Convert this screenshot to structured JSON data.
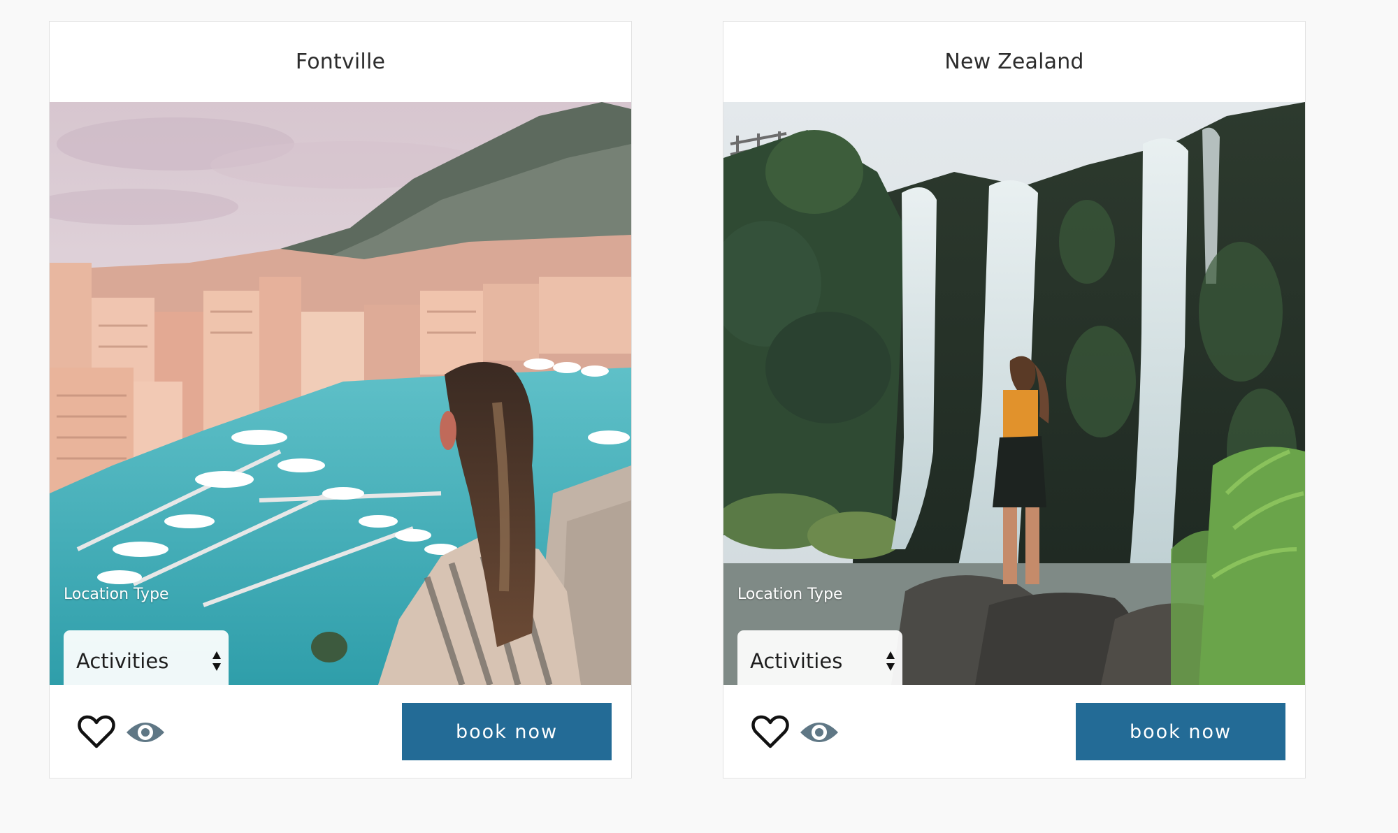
{
  "cards": [
    {
      "title": "Fontville",
      "photo_icon": "harbor-city-photo",
      "location_type_label": "Location Type",
      "location_type_value": "Activities",
      "favorite_icon": "heart-outline-icon",
      "view_icon": "eye-icon",
      "book_label": "book now"
    },
    {
      "title": "New Zealand",
      "photo_icon": "waterfall-photo",
      "location_type_label": "Location Type",
      "location_type_value": "Activities",
      "favorite_icon": "heart-outline-icon",
      "view_icon": "eye-icon",
      "book_label": "book now"
    }
  ],
  "colors": {
    "page_background": "#f9f9f9",
    "card_background": "#ffffff",
    "button_background": "#236b96",
    "button_text": "#ffffff",
    "eye_icon": "#5f7785",
    "heart_icon": "#111111"
  }
}
